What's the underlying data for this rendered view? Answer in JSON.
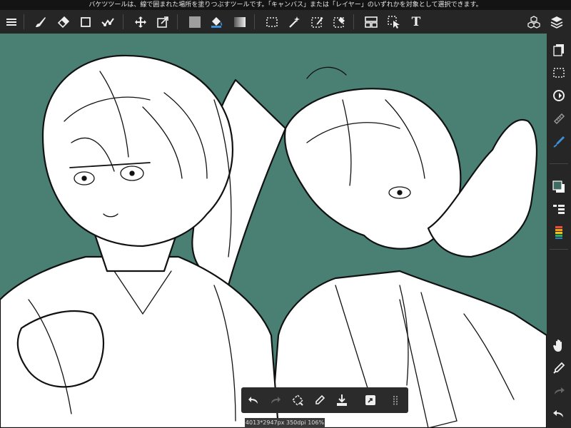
{
  "tip": {
    "text": "バケツツールは、線で囲まれた場所を塗りつぶすツールです。「キャンバス」または「レイヤー」のいずれかを対象として選択できます。"
  },
  "toolbar": {
    "left_tools": [
      "menu-icon",
      "brush-icon",
      "eraser-icon",
      "rectangle-icon",
      "stabilizer-icon"
    ],
    "middle_tools": [
      "move-icon",
      "transform-icon",
      "fill-color-icon",
      "bucket-icon",
      "gradient-icon"
    ],
    "selection_tools": [
      "select-rect-icon",
      "magic-wand-icon",
      "select-pen-icon",
      "select-eraser-icon",
      "frame-divide-icon",
      "operation-icon",
      "text-icon"
    ],
    "text_tool_label": "T",
    "right_tools": [
      "3d-material-icon",
      "layers-icon"
    ]
  },
  "sidebar": {
    "tools": [
      "pages-icon",
      "selection-icon",
      "rotate-icon",
      "ruler-icon",
      "pen-color-icon",
      "color-icon",
      "brush-list-icon",
      "palette-icon",
      "hand-icon",
      "eyedropper-icon",
      "redo-icon",
      "undo-icon"
    ],
    "current_color": "#3f6b62"
  },
  "quickbar": {
    "buttons": [
      "undo-icon",
      "redo-icon",
      "transform-icon",
      "eyedropper-icon",
      "save-icon",
      "quick-action-icon",
      "grip-icon"
    ]
  },
  "status": {
    "info": "4013*2947px 350dpi 106%"
  },
  "colors": {
    "canvas_bg": "#4a7f73",
    "toolbar_bg": "#262626",
    "fill_swatch": "#9e9e9e"
  }
}
